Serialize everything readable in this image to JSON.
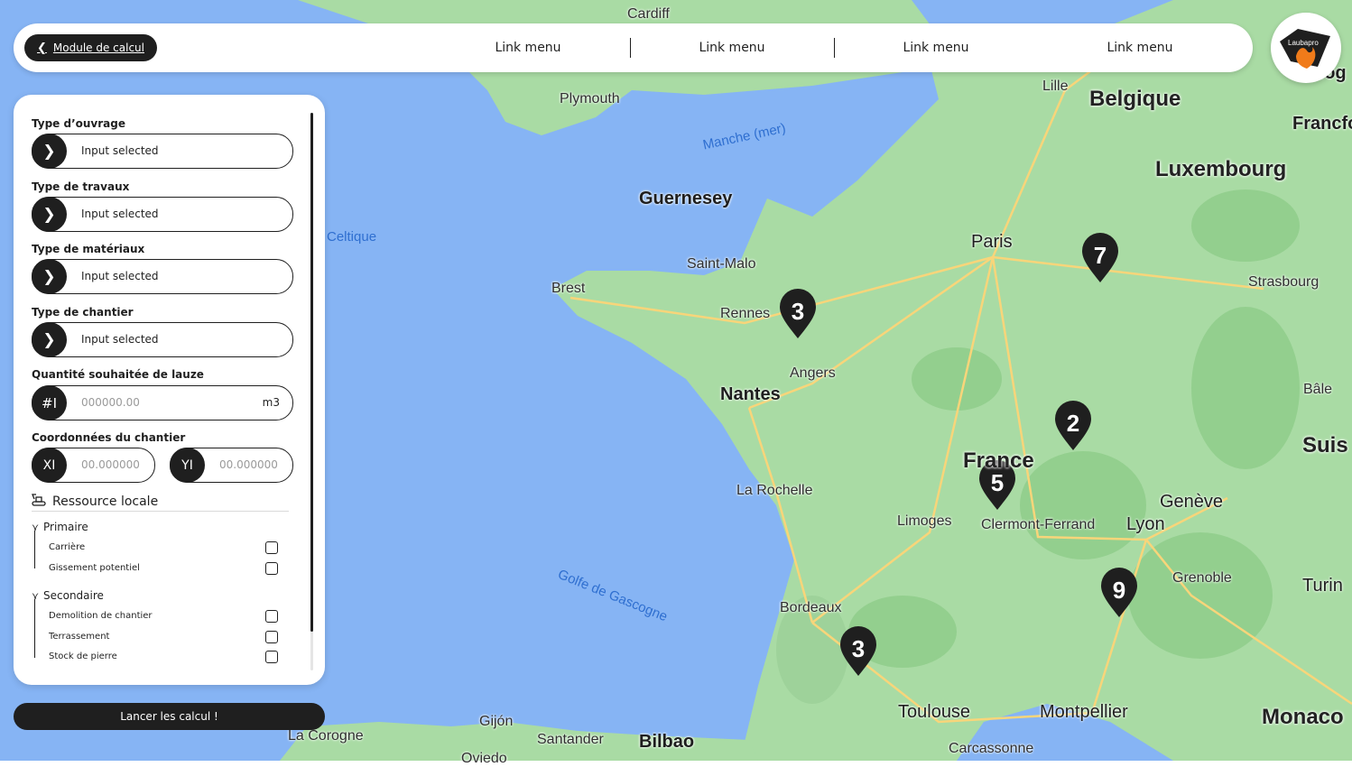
{
  "map": {
    "countries": [
      "Belgique",
      "Luxembourg",
      "France",
      "Suis",
      "Monaco"
    ],
    "islands": [
      "Guernesey"
    ],
    "seas": [
      "Manche (mer)",
      "Celtique",
      "Golfe de Gascogne"
    ],
    "cities": [
      "Cardiff",
      "Plymouth",
      "Lille",
      "Colog",
      "Francfo",
      "Paris",
      "Saint-Malo",
      "Brest",
      "Rennes",
      "Strasbourg",
      "Angers",
      "Nantes",
      "Bâle",
      "Genève",
      "Clermont-Ferrand",
      "Lyon",
      "Limoges",
      "La Rochelle",
      "Grenoble",
      "Turin",
      "Bordeaux",
      "Toulouse",
      "Montpellier",
      "Carcassonne",
      "Gijón",
      "La Corogne",
      "Santander",
      "Bilbao",
      "Oviedo"
    ],
    "markers": [
      "3",
      "7",
      "2",
      "5",
      "9",
      "3"
    ],
    "colors": {
      "sea": "#86b4f4",
      "land": "#a9dba4",
      "forest": "#93cf8e",
      "road": "#f8d57a",
      "marker": "#1f1f1f"
    }
  },
  "nav": {
    "back_label": "Module de calcul",
    "back_icon": "chevron-left-icon",
    "links": [
      "Link menu",
      "Link menu",
      "Link menu",
      "Link menu"
    ],
    "logo_text": "Laubapro"
  },
  "form": {
    "fields": [
      {
        "label": "Type d’ouvrage",
        "value": "Input selected",
        "icon": "chevron-right-icon"
      },
      {
        "label": "Type de travaux",
        "value": "Input selected",
        "icon": "chevron-right-icon"
      },
      {
        "label": "Type de matériaux",
        "value": "Input selected",
        "icon": "chevron-right-icon"
      },
      {
        "label": "Type de chantier",
        "value": "Input selected",
        "icon": "chevron-right-icon"
      }
    ],
    "quantity": {
      "label": "Quantité souhaitée de lauze",
      "icon_text": "#I",
      "placeholder": "000000.00",
      "unit": "m3"
    },
    "coords": {
      "label": "Coordonnées du chantier",
      "x_icon": "XI",
      "y_icon": "YI",
      "x_placeholder": "00.000000",
      "y_placeholder": "00.000000"
    },
    "resources": {
      "title": "Ressource locale",
      "icon": "excavator-icon",
      "groups": [
        {
          "name": "Primaire",
          "options": [
            "Carrière",
            "Gissement potentiel"
          ]
        },
        {
          "name": "Secondaire",
          "options": [
            "Demolition de chantier",
            "Terrassement",
            "Stock de pierre"
          ]
        }
      ]
    }
  },
  "launch_label": "Lancer les calcul !"
}
